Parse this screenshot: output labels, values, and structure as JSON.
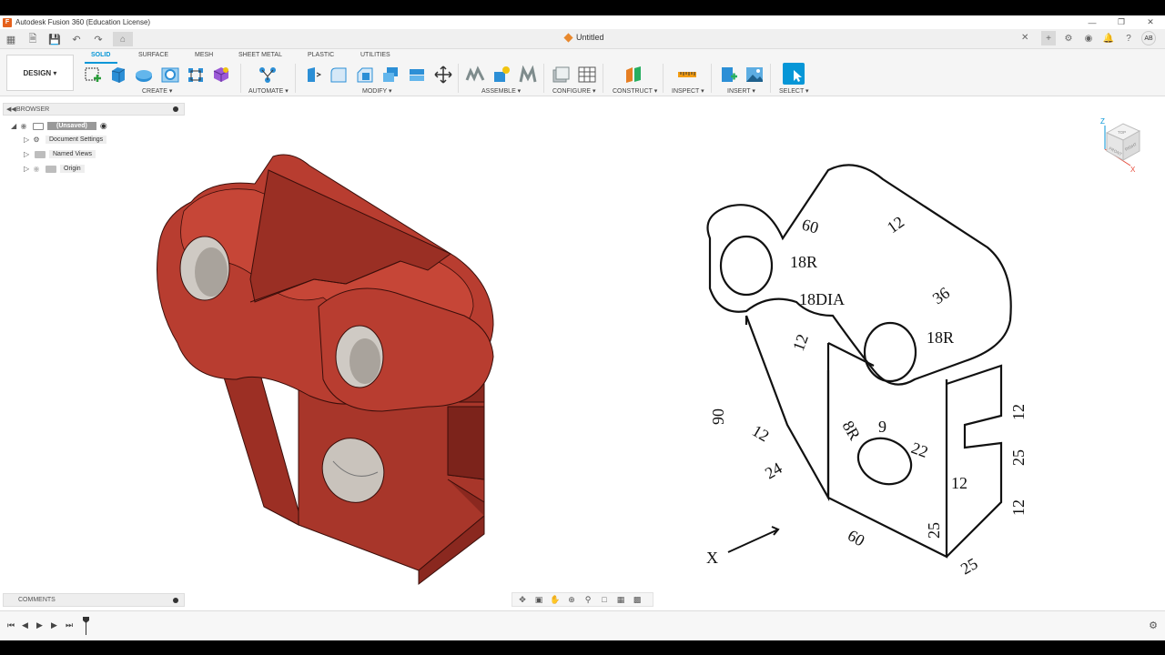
{
  "titlebar": {
    "title": "Autodesk Fusion 360 (Education License)"
  },
  "document": {
    "name": "Untitled"
  },
  "user": {
    "initials": "AB"
  },
  "ribbon": {
    "workspace": "DESIGN ▾",
    "tabs": [
      "SOLID",
      "SURFACE",
      "MESH",
      "SHEET METAL",
      "PLASTIC",
      "UTILITIES"
    ],
    "active_tab": "SOLID",
    "groups": [
      "CREATE ▾",
      "AUTOMATE ▾",
      "MODIFY ▾",
      "ASSEMBLE ▾",
      "CONFIGURE ▾",
      "CONSTRUCT ▾",
      "INSPECT ▾",
      "INSERT ▾",
      "SELECT ▾"
    ]
  },
  "browser": {
    "title": "BROWSER",
    "root": "(Unsaved)",
    "items": [
      "Document Settings",
      "Named Views",
      "Origin"
    ]
  },
  "comments": {
    "title": "COMMENTS"
  },
  "viewcube": {
    "axis_z": "Z",
    "axis_x": "X",
    "face_top": "TOP",
    "face_front": "FRONT",
    "face_right": "RIGHT"
  },
  "drawing": {
    "labels": [
      "60",
      "12",
      "18R",
      "18DIA",
      "36",
      "18R",
      "12",
      "90",
      "12",
      "8R",
      "9",
      "22",
      "12",
      "24",
      "12",
      "25",
      "12",
      "12",
      "25",
      "60",
      "25",
      "X"
    ]
  },
  "colors": {
    "accent": "#0696d7",
    "model": "#b0392c",
    "model_dark": "#7f2219",
    "logo": "#e5611c"
  }
}
